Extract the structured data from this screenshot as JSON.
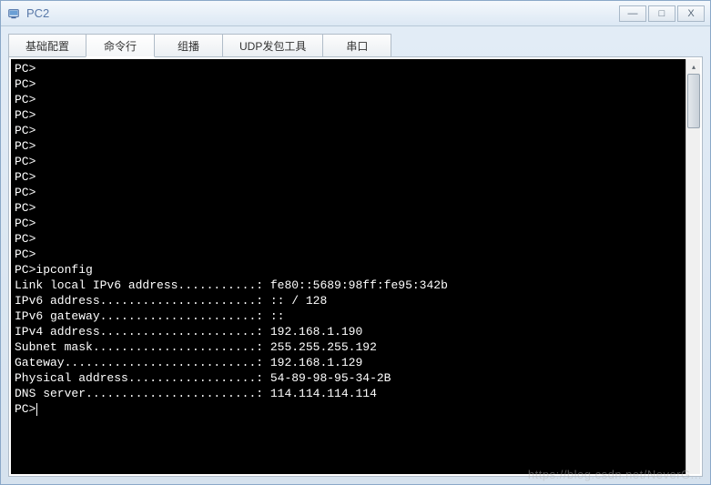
{
  "window": {
    "title": "PC2"
  },
  "tabs": [
    {
      "label": "基础配置",
      "id": "basic-config"
    },
    {
      "label": "命令行",
      "id": "command-line"
    },
    {
      "label": "组播",
      "id": "multicast"
    },
    {
      "label": "UDP发包工具",
      "id": "udp-tool"
    },
    {
      "label": "串口",
      "id": "serial"
    }
  ],
  "active_tab_index": 1,
  "terminal": {
    "prompts": [
      "PC>",
      "PC>",
      "PC>",
      "PC>",
      "PC>",
      "PC>",
      "PC>",
      "PC>",
      "PC>",
      "PC>",
      "PC>",
      "PC>",
      "PC>"
    ],
    "command_line": "PC>ipconfig",
    "blank1": "",
    "output": [
      "Link local IPv6 address...........: fe80::5689:98ff:fe95:342b",
      "IPv6 address......................: :: / 128",
      "IPv6 gateway......................: ::",
      "IPv4 address......................: 192.168.1.190",
      "Subnet mask.......................: 255.255.255.192",
      "Gateway...........................: 192.168.1.129",
      "Physical address..................: 54-89-98-95-34-2B",
      "DNS server........................: 114.114.114.114"
    ],
    "blank2": "",
    "blank3": "",
    "final_prompt": "PC>"
  },
  "watermark": "https://blog.csdn.net/NeverG..."
}
